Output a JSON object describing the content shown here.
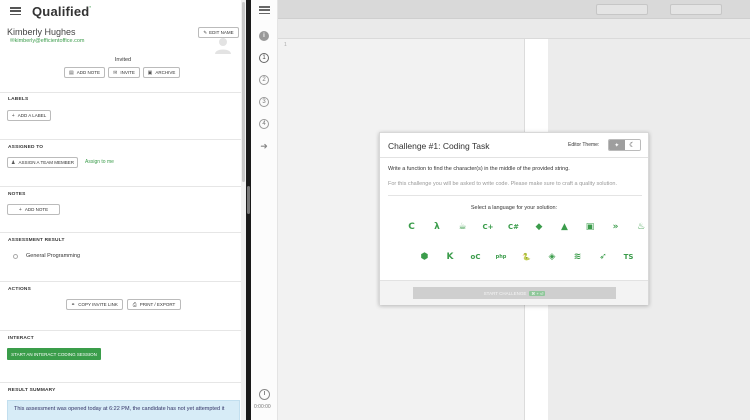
{
  "app": {
    "logo": "Qualified",
    "logo_mark": "'"
  },
  "candidate": {
    "name": "Kimberly Hughes",
    "email": "kimberly@efficientoffice.com",
    "status": "Invited",
    "edit_name_label": "EDIT NAME"
  },
  "actions_row": {
    "add_note": "ADD NOTE",
    "invite": "INVITE",
    "archive": "ARCHIVE"
  },
  "labels": {
    "title": "LABELS",
    "add_label": "ADD A LABEL"
  },
  "assigned": {
    "title": "ASSIGNED TO",
    "assign_member": "ASSIGN A TEAM MEMBER",
    "assign_me": "Assign to me"
  },
  "notes": {
    "title": "NOTES",
    "add_note": "ADD NOTE"
  },
  "assessment": {
    "title": "ASSESSMENT RESULT",
    "item": "General Programming"
  },
  "actions": {
    "title": "ACTIONS",
    "copy_link": "COPY INVITE LINK",
    "print_export": "PRINT / EXPORT"
  },
  "interact": {
    "title": "INTERACT",
    "start_session": "START AN INTERACT CODING SESSION"
  },
  "result_summary": {
    "title": "RESULT SUMMARY",
    "text": "This assessment was opened today at 6:22 PM, the candidate has not yet attempted it"
  },
  "ide": {
    "rail_numbers": [
      "1",
      "2",
      "3",
      "4"
    ],
    "timer": "0:00:00",
    "gutter_line": "1"
  },
  "modal": {
    "title": "Challenge #1: Coding Task",
    "theme_label": "Editor Theme:",
    "description": "Write a function to find the character(s) in the middle of the provided string.",
    "note": "For this challenge you will be asked to write code. Please make sure to craft a quality solution.",
    "language_prompt": "Select a language for your solution:",
    "start_button": "START CHALLENGE",
    "start_shortcut": "⌘ + ⏎",
    "languages_row1": [
      {
        "icon": "c-icon",
        "glyph": "C"
      },
      {
        "icon": "clojure-icon",
        "glyph": "λ"
      },
      {
        "icon": "coffeescript-icon",
        "glyph": "☕"
      },
      {
        "icon": "cpp-icon",
        "glyph": "C+"
      },
      {
        "icon": "csharp-icon",
        "glyph": "C#"
      },
      {
        "icon": "dart-icon",
        "glyph": "◆"
      },
      {
        "icon": "elixir-icon",
        "glyph": "▲"
      },
      {
        "icon": "go-icon",
        "glyph": "▣"
      },
      {
        "icon": "haskell-icon",
        "glyph": "»"
      },
      {
        "icon": "java-icon",
        "glyph": "♨"
      }
    ],
    "languages_row2": [
      {
        "icon": "nodejs-icon",
        "glyph": "⬢"
      },
      {
        "icon": "kotlin-icon",
        "glyph": "K"
      },
      {
        "icon": "objc-icon",
        "glyph": "oC"
      },
      {
        "icon": "php-icon",
        "glyph": "php"
      },
      {
        "icon": "python-icon",
        "glyph": "🐍"
      },
      {
        "icon": "ruby-icon",
        "glyph": "◈"
      },
      {
        "icon": "scala-icon",
        "glyph": "≋"
      },
      {
        "icon": "swift-icon",
        "glyph": "➶"
      },
      {
        "icon": "typescript-icon",
        "glyph": "TS"
      }
    ]
  }
}
